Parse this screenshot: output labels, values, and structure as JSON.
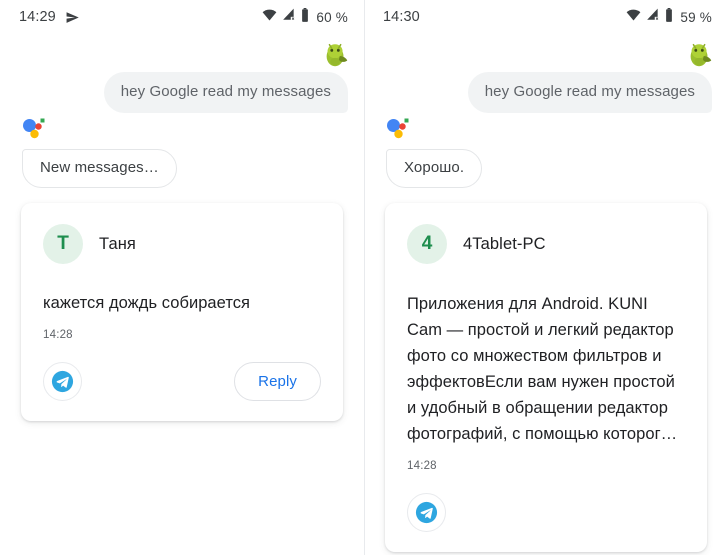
{
  "panels": [
    {
      "id": "left",
      "status": {
        "time": "14:29",
        "send_icon": "paper-plane-icon",
        "wifi_icon": "wifi-icon",
        "signal_icon": "cellular-signal-icon",
        "battery_icon": "battery-icon",
        "battery_text": "60 %"
      },
      "user_avatar_icon": "android-avatar-icon",
      "user_message": "hey Google read my messages",
      "assistant_logo_icon": "google-assistant-icon",
      "assistant_message": "New messages…",
      "card": {
        "avatar_letter": "Т",
        "sender": "Таня",
        "body": "кажется дождь собирается",
        "time": "14:28",
        "app_icon": "telegram-icon",
        "reply_label": "Reply",
        "has_reply": true
      }
    },
    {
      "id": "right",
      "status": {
        "time": "14:30",
        "send_icon": "",
        "wifi_icon": "wifi-icon",
        "signal_icon": "cellular-signal-icon",
        "battery_icon": "battery-icon",
        "battery_text": "59 %"
      },
      "user_avatar_icon": "android-avatar-icon",
      "user_message": "hey Google read my messages",
      "assistant_logo_icon": "google-assistant-icon",
      "assistant_message": "Хорошо.",
      "card": {
        "avatar_letter": "4",
        "sender": "4Tablet-PC",
        "body": "Приложения для Android. KUNI Cam — простой и легкий редактор фото со множеством фильтров и эффектовЕсли вам нужен простой и удобный в обращении редактор фотографий, с помощью которог…",
        "time": "14:28",
        "app_icon": "telegram-icon",
        "reply_label": "",
        "has_reply": false
      }
    }
  ],
  "colors": {
    "assistant_blue": "#4285f4",
    "assistant_red": "#ea4335",
    "assistant_yellow": "#fbbc05",
    "assistant_green": "#34a853",
    "telegram_blue": "#2ea6e0",
    "reply_blue": "#1a73e8",
    "avatar_bg": "#e3f2e8",
    "avatar_fg": "#1e8e4e",
    "user_bubble_bg": "#f1f3f4",
    "text_primary": "#202124",
    "text_secondary": "#5f6368"
  }
}
